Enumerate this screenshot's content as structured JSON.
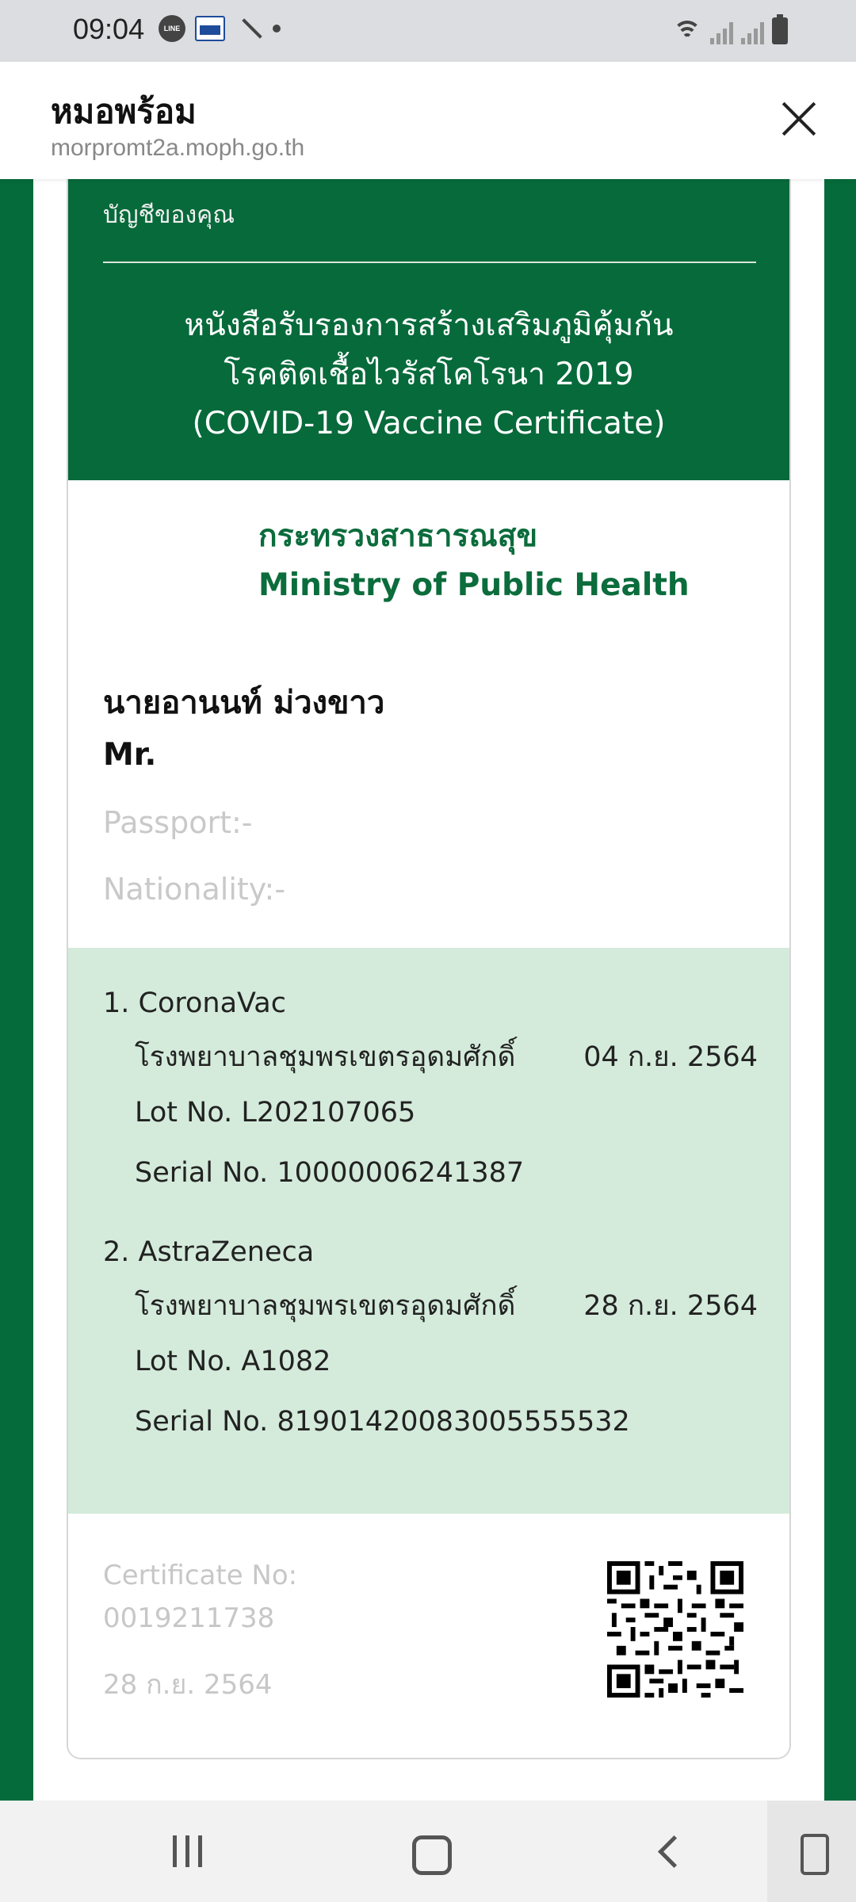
{
  "status_bar": {
    "time": "09:04",
    "line_badge": "LINE"
  },
  "browser": {
    "title": "หมอพร้อม",
    "url": "morpromt2a.moph.go.th"
  },
  "certificate": {
    "account_label": "บัญชีของคุณ",
    "title_line1": "หนังสือรับรองการสร้างเสริมภูมิคุ้มกัน",
    "title_line2": "โรคติดเชื้อไวรัสโคโรนา 2019",
    "title_line3": "(COVID-19 Vaccine Certificate)",
    "ministry_th": "กระทรวงสาธารณสุข",
    "ministry_en": "Ministry of Public Health",
    "person_name": "นายอานนท์ ม่วงขาว",
    "person_title": "Mr.",
    "passport": "Passport:-",
    "nationality": "Nationality:-",
    "vaccines": [
      {
        "name": "1. CoronaVac",
        "hospital": "โรงพยาบาลชุมพรเขตรอุดมศักดิ์",
        "date": "04 ก.ย. 2564",
        "lot": "Lot No. L202107065",
        "serial": "Serial No. 10000006241387"
      },
      {
        "name": "2. AstraZeneca",
        "hospital": "โรงพยาบาลชุมพรเขตรอุดมศักดิ์",
        "date": "28 ก.ย. 2564",
        "lot": "Lot No. A1082",
        "serial": "Serial No. 81901420083005555532"
      }
    ],
    "certificate_no_label": "Certificate No:",
    "certificate_no": "0019211738",
    "issue_date": "28 ก.ย. 2564"
  },
  "icons": {
    "close": "close-icon",
    "qr": "qr-code-icon",
    "nav_recents": "recents-icon",
    "nav_home": "home-icon",
    "nav_back": "back-icon"
  },
  "colors": {
    "brand_green": "#076a3b",
    "vaccine_bg": "#d4ebdb",
    "muted_text": "#c7c7c7"
  }
}
